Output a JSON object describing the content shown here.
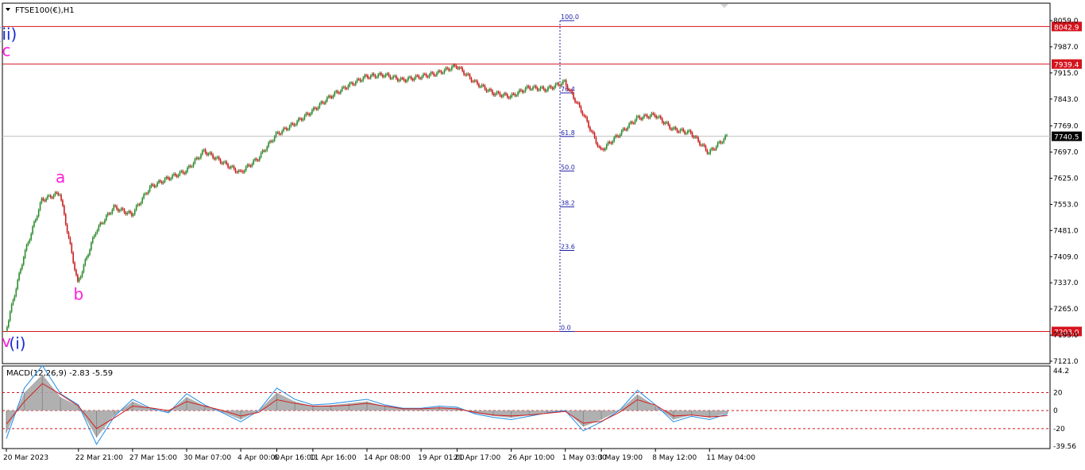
{
  "header": {
    "symbol_label": "FTSE100(€),H1"
  },
  "colors": {
    "up_candle": "#2e8b2e",
    "down_candle": "#c81e1e",
    "level_line": "#d4141e",
    "fib_line": "#2222aa",
    "wave_magenta": "#ff1fd9",
    "wave_blue": "#1a2cd6",
    "macd_hist": "#a7a7a7",
    "macd_line": "#1e8ce6",
    "signal_line": "#d41e1e",
    "current_price_bg": "#000000"
  },
  "chart_data": [
    {
      "type": "line",
      "title": "FTSE100(€),H1",
      "ylim": [
        7121.0,
        8059.0
      ],
      "x_ticks": [
        "20 Mar 2023",
        "22 Mar 21:00",
        "27 Mar 15:00",
        "30 Mar 07:00",
        "4 Apr 00:00",
        "6 Apr 16:00",
        "11 Apr 16:00",
        "14 Apr 08:00",
        "19 Apr 01:00",
        "21 Apr 17:00",
        "26 Apr 10:00",
        "1 May 03:00",
        "3 May 19:00",
        "8 May 12:00",
        "11 May 04:00"
      ],
      "y_ticks": [
        8059.0,
        7987.0,
        7915.0,
        7843.0,
        7769.0,
        7697.0,
        7625.0,
        7553.0,
        7481.0,
        7409.0,
        7337.0,
        7265.0,
        7193.0,
        7121.0
      ],
      "series": [
        {
          "x": [
            "20 Mar 2023",
            "20 Mar 2023 08:00",
            "21 Mar 2023",
            "22 Mar 2023",
            "22 Mar 21:00",
            "23 Mar 2023",
            "24 Mar 2023",
            "27 Mar 15:00",
            "28 Mar 2023",
            "29 Mar 2023",
            "30 Mar 07:00",
            "31 Mar 2023",
            "3 Apr 2023",
            "4 Apr 00:00",
            "5 Apr 2023",
            "6 Apr 16:00",
            "11 Apr 2023",
            "11 Apr 16:00",
            "12 Apr 2023",
            "13 Apr 2023",
            "14 Apr 08:00",
            "17 Apr 2023",
            "18 Apr 2023",
            "19 Apr 01:00",
            "20 Apr 2023",
            "21 Apr 17:00",
            "24 Apr 2023",
            "25 Apr 2023",
            "26 Apr 10:00",
            "27 Apr 2023",
            "28 Apr 2023",
            "1 May 03:00",
            "2 May 2023",
            "3 May 19:00",
            "4 May 2023",
            "5 May 2023",
            "8 May 12:00",
            "9 May 2023",
            "10 May 2023",
            "11 May 04:00",
            "11 May 2023"
          ],
          "values": [
            7203,
            7410,
            7565,
            7585,
            7335,
            7480,
            7545,
            7525,
            7600,
            7625,
            7645,
            7700,
            7670,
            7640,
            7680,
            7745,
            7775,
            7810,
            7850,
            7880,
            7905,
            7910,
            7895,
            7905,
            7915,
            7935,
            7890,
            7860,
            7850,
            7875,
            7870,
            7890,
            7805,
            7700,
            7745,
            7790,
            7800,
            7760,
            7750,
            7695,
            7740.5
          ]
        }
      ],
      "current_price": 7740.5,
      "price_levels": [
        8042.9,
        7939.4,
        7203.0
      ],
      "fibonacci_levels": [
        {
          "label": "100.0",
          "value": 8059.0
        },
        {
          "label": "76.4",
          "value": 7860.0
        },
        {
          "label": "61.8",
          "value": 7740.0
        },
        {
          "label": "50.0",
          "value": 7645.0
        },
        {
          "label": "38.2",
          "value": 7546.0
        },
        {
          "label": "23.6",
          "value": 7426.0
        },
        {
          "label": "0.0",
          "value": 7203.0
        }
      ],
      "wave_labels": [
        {
          "text": "(ii)",
          "x": "21 Apr 2023",
          "value": 8006.0
        },
        {
          "text": "c",
          "x": "21 Apr 2023",
          "value": 7962.0
        },
        {
          "text": "a",
          "x": "22 Mar 2023",
          "value": 7613.0
        },
        {
          "text": "b",
          "x": "22 Mar 21:00",
          "value": 7290.0
        },
        {
          "text": "v",
          "x": "20 Mar 2023",
          "value": 7160.0
        },
        {
          "text": "(i)",
          "x": "20 Mar 2023",
          "value": 7155.0
        }
      ]
    },
    {
      "type": "bar",
      "title": "MACD(12,26,9) -2.83 -5.59",
      "ylim": [
        -39.56,
        44.2
      ],
      "y_ticks": [
        44.2,
        20.0,
        0.0,
        -20.0,
        -39.56
      ],
      "levels": [
        20.0,
        0.0,
        -20.0
      ],
      "macd_value": -2.83,
      "signal_value": -5.59,
      "x": [
        "20 Mar 2023",
        "20 Mar 2023 08:00",
        "21 Mar 2023",
        "22 Mar 2023",
        "22 Mar 21:00",
        "23 Mar 2023",
        "24 Mar 2023",
        "27 Mar 15:00",
        "28 Mar 2023",
        "29 Mar 2023",
        "30 Mar 07:00",
        "31 Mar 2023",
        "3 Apr 2023",
        "4 Apr 00:00",
        "5 Apr 2023",
        "6 Apr 16:00",
        "11 Apr 2023",
        "11 Apr 16:00",
        "12 Apr 2023",
        "13 Apr 2023",
        "14 Apr 08:00",
        "17 Apr 2023",
        "18 Apr 2023",
        "19 Apr 01:00",
        "20 Apr 2023",
        "21 Apr 17:00",
        "24 Apr 2023",
        "25 Apr 2023",
        "26 Apr 10:00",
        "27 Apr 2023",
        "28 Apr 2023",
        "1 May 03:00",
        "2 May 2023",
        "3 May 19:00",
        "4 May 2023",
        "5 May 2023",
        "8 May 12:00",
        "9 May 2023",
        "10 May 2023",
        "11 May 04:00",
        "11 May 2023"
      ],
      "series": [
        {
          "name": "histogram",
          "values": [
            -25,
            20,
            40,
            15,
            5,
            -30,
            -5,
            10,
            2,
            -2,
            15,
            5,
            -2,
            -10,
            0,
            20,
            10,
            5,
            6,
            8,
            10,
            5,
            2,
            2,
            4,
            3,
            -3,
            -6,
            -8,
            -5,
            -2,
            0,
            -18,
            -10,
            0,
            18,
            5,
            -10,
            -5,
            -8,
            -2.83
          ]
        },
        {
          "name": "signal",
          "values": [
            -15,
            10,
            30,
            18,
            5,
            -20,
            -8,
            5,
            3,
            0,
            10,
            5,
            0,
            -6,
            -2,
            12,
            8,
            5,
            5,
            6,
            8,
            5,
            2,
            2,
            3,
            2,
            -2,
            -5,
            -6,
            -5,
            -3,
            -1,
            -14,
            -12,
            -2,
            12,
            6,
            -6,
            -5,
            -7,
            -5.59
          ]
        }
      ]
    }
  ]
}
